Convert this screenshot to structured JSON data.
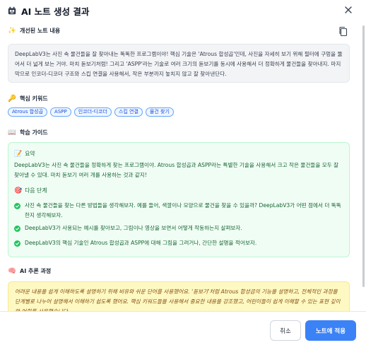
{
  "dialog": {
    "title": "AI 노트 생성 결과",
    "icon": "robot-icon"
  },
  "improved_note": {
    "heading": "개선된 노트 내용",
    "heading_icon": "sparkles-icon",
    "text": "DeepLabV3는 사진 속 물건들을 잘 찾아내는 똑똑한 프로그램이야! 핵심 기술은 'Atrous 합성곱'인데, 사진을 자세히 보기 위해 필터에 구멍을 뚫어서 더 넓게 보는 거야. 마치 돋보기처럼! 그리고 'ASPP'라는 기술로 여러 크기의 돋보기를 동시에 사용해서 더 정확하게 물건들을 찾아내지. 마지막으로 인코더-디코더 구조와 스킵 연결을 사용해서, 작은 부분까지 놓치지 않고 잘 찾아낸단다."
  },
  "keywords": {
    "heading": "핵심 키워드",
    "heading_icon": "key-icon",
    "items": [
      "Atrous 합성곱",
      "ASPP",
      "인코더-디코더",
      "스킵 연결",
      "물건 찾기"
    ]
  },
  "learning_guide": {
    "heading": "학습 가이드",
    "heading_icon": "book-icon",
    "summary_label": "요약",
    "summary_icon": "memo-icon",
    "summary_text": "DeepLabV3는 사진 속 물건들을 정확하게 찾는 프로그램이야. Atrous 합성곱과 ASPP라는 특별한 기술을 사용해서 크고 작은 물건들을 모두 잘 찾아낼 수 있대. 마치 돋보기 여러 개를 사용하는 것과 같지!",
    "next_label": "다음 단계",
    "next_icon": "target-icon",
    "steps": [
      "사진 속 물건들을 찾는 다른 방법들을 생각해보자. 예를 들어, 색깔이나 모양으로 물건을 찾을 수 있을까? DeepLabV3가 어떤 점에서 더 똑똑한지 생각해보자.",
      "DeepLabV3가 사용되는 예시를 찾아보고, 그림이나 영상을 보면서 어떻게 작동하는지 살펴보자.",
      "DeepLabV3의 핵심 기술인 Atrous 합성곱과 ASPP에 대해 그림을 그려거나, 간단한 설명을 적어보자."
    ]
  },
  "reasoning": {
    "heading": "AI 추론 과정",
    "heading_icon": "brain-icon",
    "text": "어려운 내용을 쉽게 이해하도록 설명하기 위해 비유와 쉬운 단어를 사용했어요. '돋보기'처럼 Atrous 합성곱의 기능을 설명하고, 전체적인 과정을 단계별로 나누어 설명해서 이해하기 쉽도록 했어요. 핵심 키워드들을 사용해서 중요한 내용을 강조했고, 어린이들이 쉽게 이해할 수 있는 표현 깊이와 어휘를 사용했습니다."
  },
  "footer": {
    "cancel_label": "취소",
    "apply_label": "노트에 적용"
  },
  "colors": {
    "primary": "#3b82f6",
    "guide_bg": "#f0fdf4",
    "guide_text": "#166534",
    "reason_bg": "#fef9c3",
    "chip_border": "#60a5fa"
  }
}
